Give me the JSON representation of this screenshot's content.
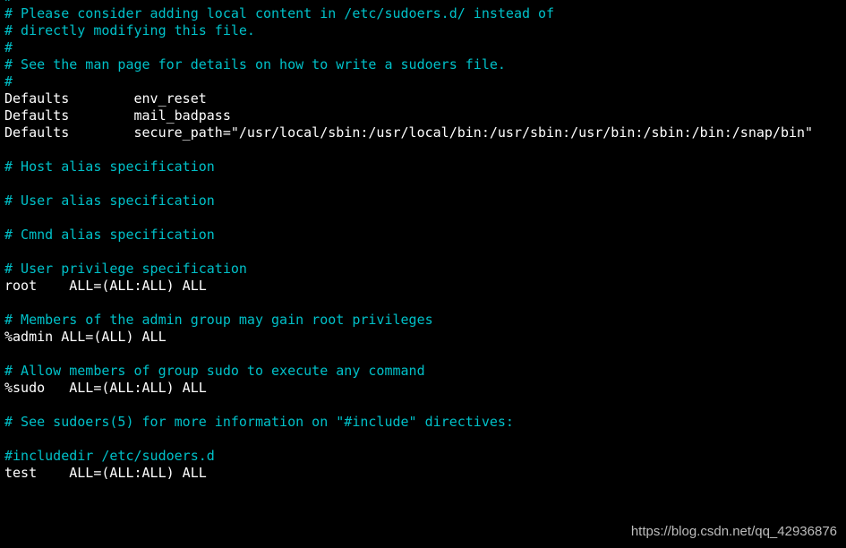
{
  "colors": {
    "background": "#000000",
    "comment": "#00c0c8",
    "text": "#ffffff",
    "watermark": "#bdbdbd"
  },
  "editor": {
    "lines": [
      {
        "text": "#",
        "type": "comment"
      },
      {
        "text": "# Please consider adding local content in /etc/sudoers.d/ instead of",
        "type": "comment"
      },
      {
        "text": "# directly modifying this file.",
        "type": "comment"
      },
      {
        "text": "#",
        "type": "comment"
      },
      {
        "text": "# See the man page for details on how to write a sudoers file.",
        "type": "comment"
      },
      {
        "text": "#",
        "type": "comment"
      },
      {
        "text": "Defaults        env_reset",
        "type": "code"
      },
      {
        "text": "Defaults        mail_badpass",
        "type": "code"
      },
      {
        "text": "Defaults        secure_path=\"/usr/local/sbin:/usr/local/bin:/usr/sbin:/usr/bin:/sbin:/bin:/snap/bin\"",
        "type": "code"
      },
      {
        "text": "",
        "type": "code"
      },
      {
        "text": "# Host alias specification",
        "type": "comment"
      },
      {
        "text": "",
        "type": "code"
      },
      {
        "text": "# User alias specification",
        "type": "comment"
      },
      {
        "text": "",
        "type": "code"
      },
      {
        "text": "# Cmnd alias specification",
        "type": "comment"
      },
      {
        "text": "",
        "type": "code"
      },
      {
        "text": "# User privilege specification",
        "type": "comment"
      },
      {
        "text": "root    ALL=(ALL:ALL) ALL",
        "type": "code"
      },
      {
        "text": "",
        "type": "code"
      },
      {
        "text": "# Members of the admin group may gain root privileges",
        "type": "comment"
      },
      {
        "text": "%admin ALL=(ALL) ALL",
        "type": "code"
      },
      {
        "text": "",
        "type": "code"
      },
      {
        "text": "# Allow members of group sudo to execute any command",
        "type": "comment"
      },
      {
        "text": "%sudo   ALL=(ALL:ALL) ALL",
        "type": "code"
      },
      {
        "text": "",
        "type": "code"
      },
      {
        "text": "# See sudoers(5) for more information on \"#include\" directives:",
        "type": "comment"
      },
      {
        "text": "",
        "type": "code"
      },
      {
        "text": "#includedir /etc/sudoers.d",
        "type": "comment"
      },
      {
        "text": "test    ALL=(ALL:ALL) ALL",
        "type": "code"
      }
    ]
  },
  "watermark": "https://blog.csdn.net/qq_42936876"
}
